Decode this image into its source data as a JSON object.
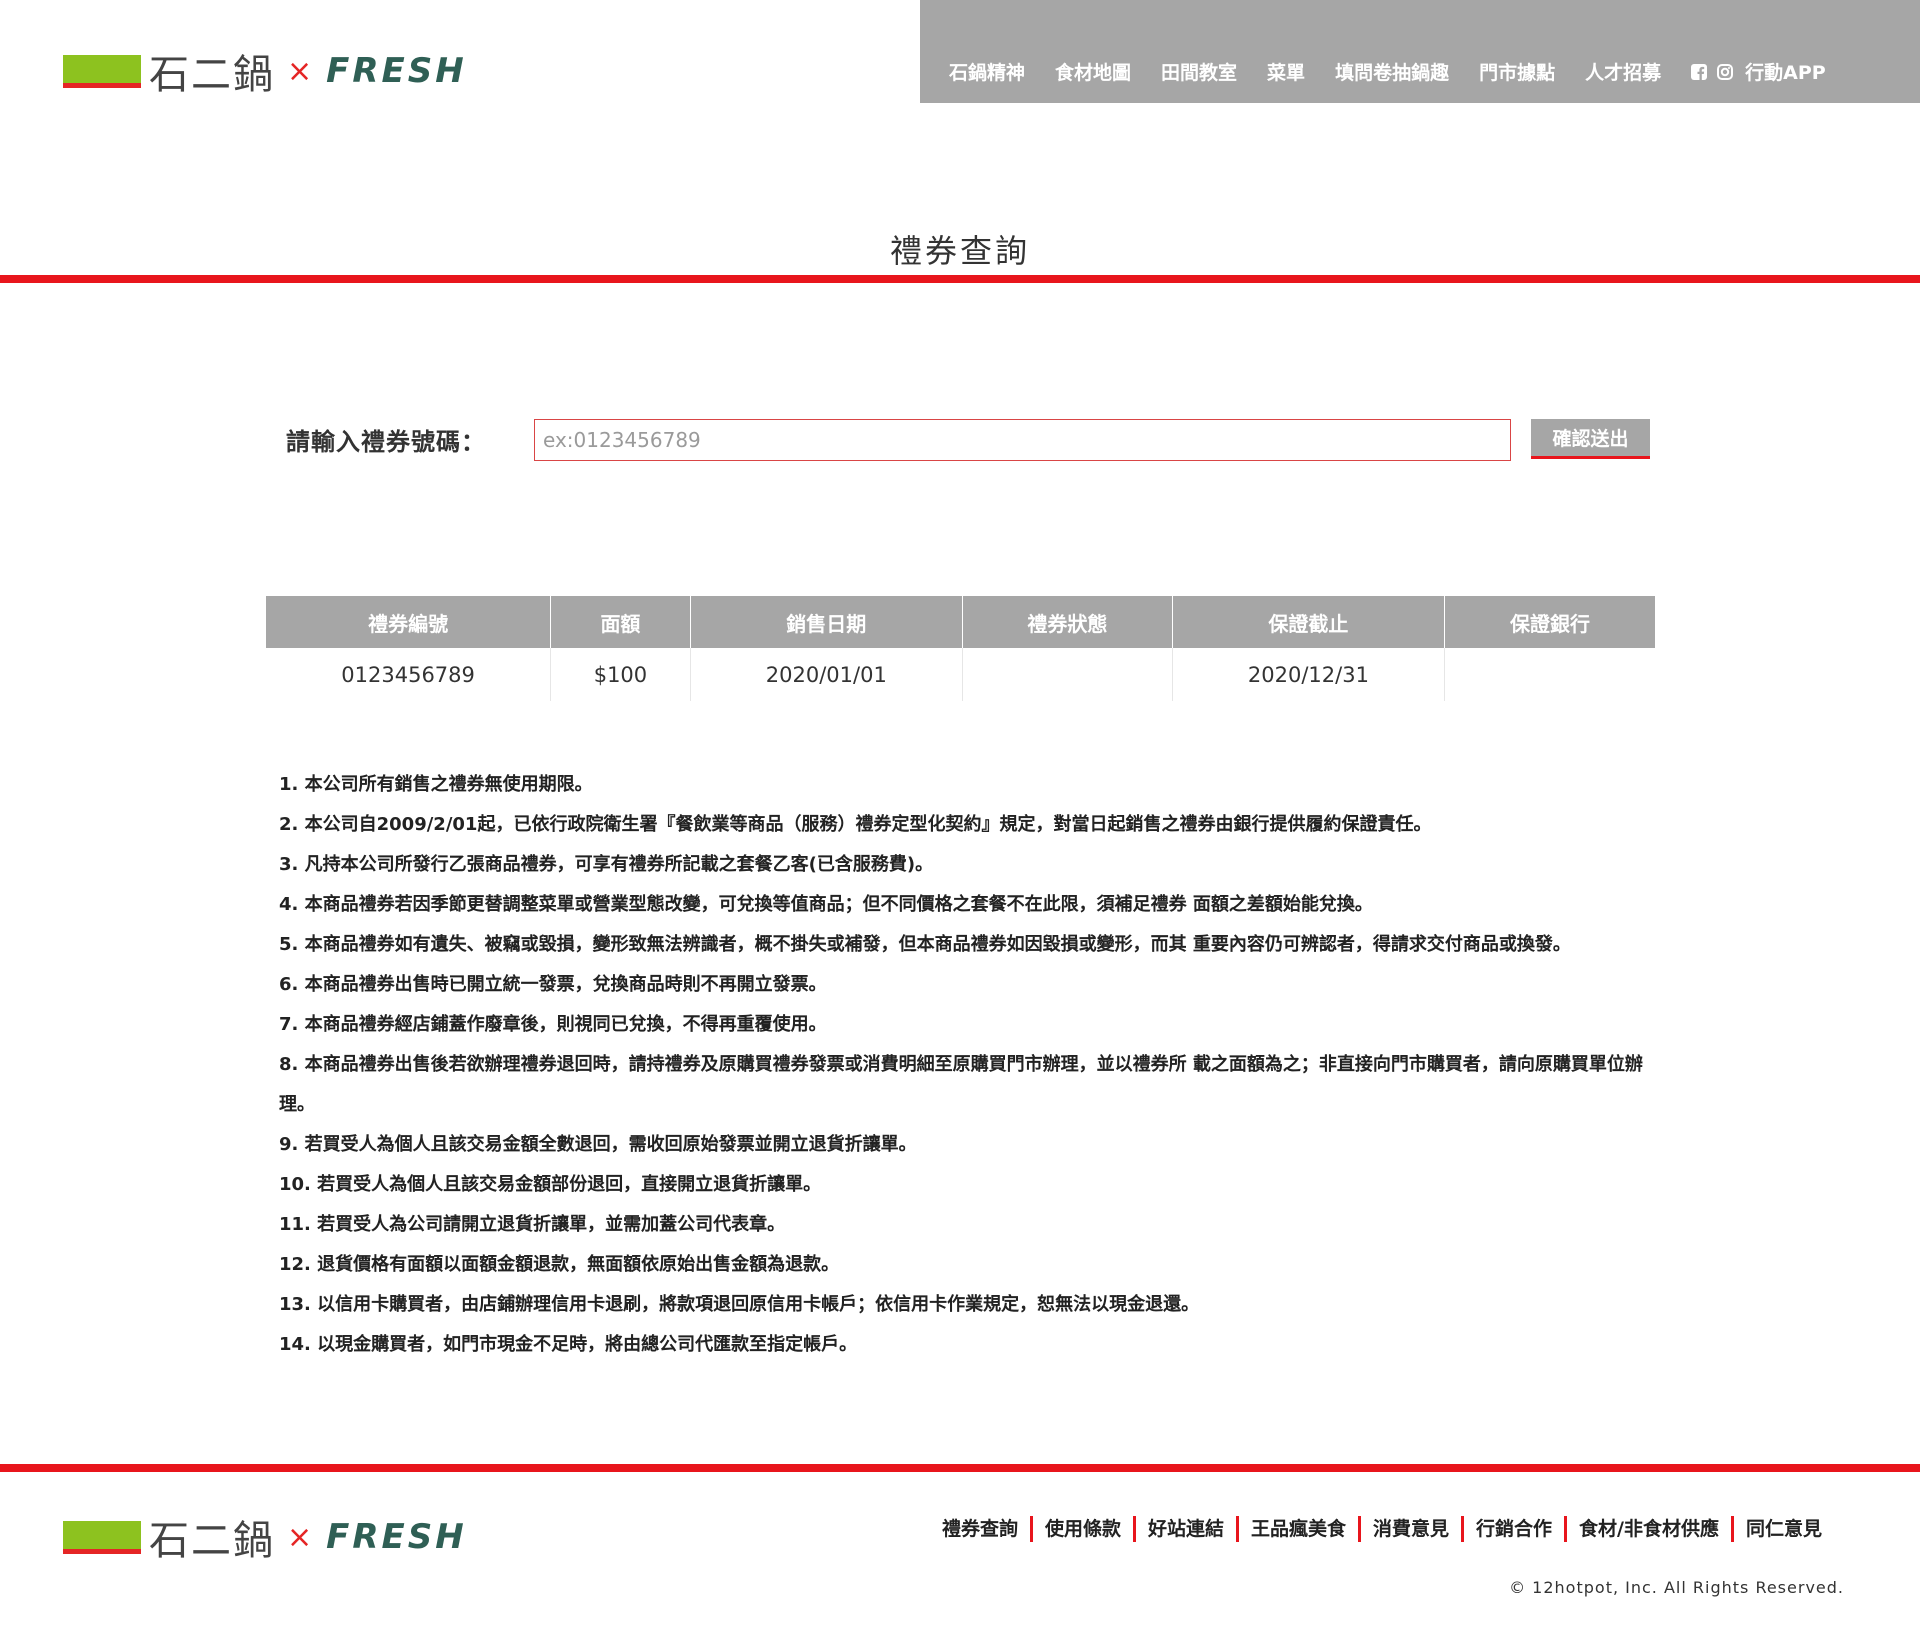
{
  "brand": {
    "name_cn": "石二鍋",
    "x": "×",
    "fresh": "FRESH",
    "colors": {
      "green": "#8dc21f",
      "red": "#e52525",
      "fresh": "#2f5f55"
    }
  },
  "header": {
    "nav": [
      "石鍋精神",
      "食材地圖",
      "田間教室",
      "菜單",
      "填問卷抽鍋趣",
      "門市據點",
      "人才招募"
    ],
    "social_icons": [
      "facebook-icon",
      "instagram-icon"
    ],
    "app_label": "行動APP",
    "bg_color": "#a6a6a6"
  },
  "page": {
    "title": "禮券查詢",
    "accent_color": "#e8151c"
  },
  "query": {
    "label": "請輸入禮券號碼：",
    "placeholder": "ex:0123456789",
    "submit_label": "確認送出"
  },
  "table": {
    "headers": [
      "禮券編號",
      "面額",
      "銷售日期",
      "禮券狀態",
      "保證截止",
      "保證銀行"
    ],
    "rows": [
      [
        "0123456789",
        "$100",
        "2020/01/01",
        "",
        "2020/12/31",
        ""
      ]
    ]
  },
  "notes": [
    "1.  本公司所有銷售之禮券無使用期限。",
    "2.  本公司自2009/2/01起，已依行政院衛生署『餐飲業等商品（服務）禮券定型化契約』規定，對當日起銷售之禮券由銀行提供履約保證責任。",
    "3.  凡持本公司所發行乙張商品禮券，可享有禮券所記載之套餐乙客(已含服務費)。",
    "4.  本商品禮券若因季節更替調整菜單或營業型態改變，可兌換等值商品；但不同價格之套餐不在此限，須補足禮券 面額之差額始能兌換。",
    "5.  本商品禮券如有遺失、被竊或毀損，變形致無法辨識者，概不掛失或補發，但本商品禮券如因毀損或變形，而其 重要內容仍可辨認者，得請求交付商品或換發。",
    "6.  本商品禮券出售時已開立統一發票，兌換商品時則不再開立發票。",
    "7.  本商品禮券經店鋪蓋作廢章後，則視同已兌換，不得再重覆使用。",
    "8.  本商品禮券出售後若欲辦理禮券退回時，請持禮券及原購買禮券發票或消費明細至原購買門市辦理，並以禮券所 載之面額為之；非直接向門市購買者，請向原購買單位辦理。",
    "9.  若買受人為個人且該交易金額全數退回，需收回原始發票並開立退貨折讓單。",
    "10. 若買受人為個人且該交易金額部份退回，直接開立退貨折讓單。",
    "11. 若買受人為公司請開立退貨折讓單，並需加蓋公司代表章。",
    "12. 退貨價格有面額以面額金額退款，無面額依原始出售金額為退款。",
    "13. 以信用卡購買者，由店鋪辦理信用卡退刷，將款項退回原信用卡帳戶；依信用卡作業規定，恕無法以現金退還。",
    "14. 以現金購買者，如門市現金不足時，將由總公司代匯款至指定帳戶。"
  ],
  "footer": {
    "links": [
      "禮券查詢",
      "使用條款",
      "好站連結",
      "王品瘋美食",
      "消費意見",
      "行銷合作",
      "食材/非食材供應",
      "同仁意見"
    ],
    "copyright": "© 12hotpot, Inc. All Rights Reserved."
  }
}
